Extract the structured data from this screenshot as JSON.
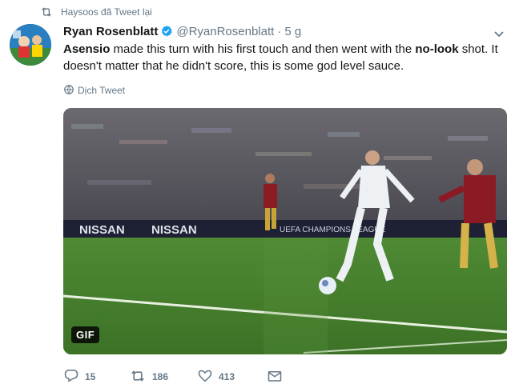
{
  "retweet_context": {
    "text": "Haysoos đã Tweet lại"
  },
  "tweet": {
    "author_name": "Ryan Rosenblatt",
    "handle": "@RyanRosenblatt",
    "separator": "·",
    "time": "5 g",
    "text_parts": {
      "p1": "Asensio",
      "p2": " made this turn with his first touch and then went with the ",
      "p3": "no-look",
      "p4": " shot. It doesn't matter that he didn't score, this is some god level sauce."
    },
    "translate_label": "Dịch Tweet",
    "media": {
      "badge": "GIF",
      "ad_boards": [
        "NISSAN",
        "NISSAN",
        "UEFA CHAMPIONS LEAGUE"
      ]
    },
    "actions": {
      "reply_count": "15",
      "retweet_count": "186",
      "like_count": "413"
    }
  },
  "colors": {
    "text": "#14171a",
    "secondary": "#657786",
    "verified": "#1da1f2",
    "pitch": "#3f7a2c"
  },
  "icons": [
    "retweet-icon",
    "verified-icon",
    "caret-down-icon",
    "globe-icon",
    "reply-icon",
    "like-icon",
    "message-icon"
  ]
}
